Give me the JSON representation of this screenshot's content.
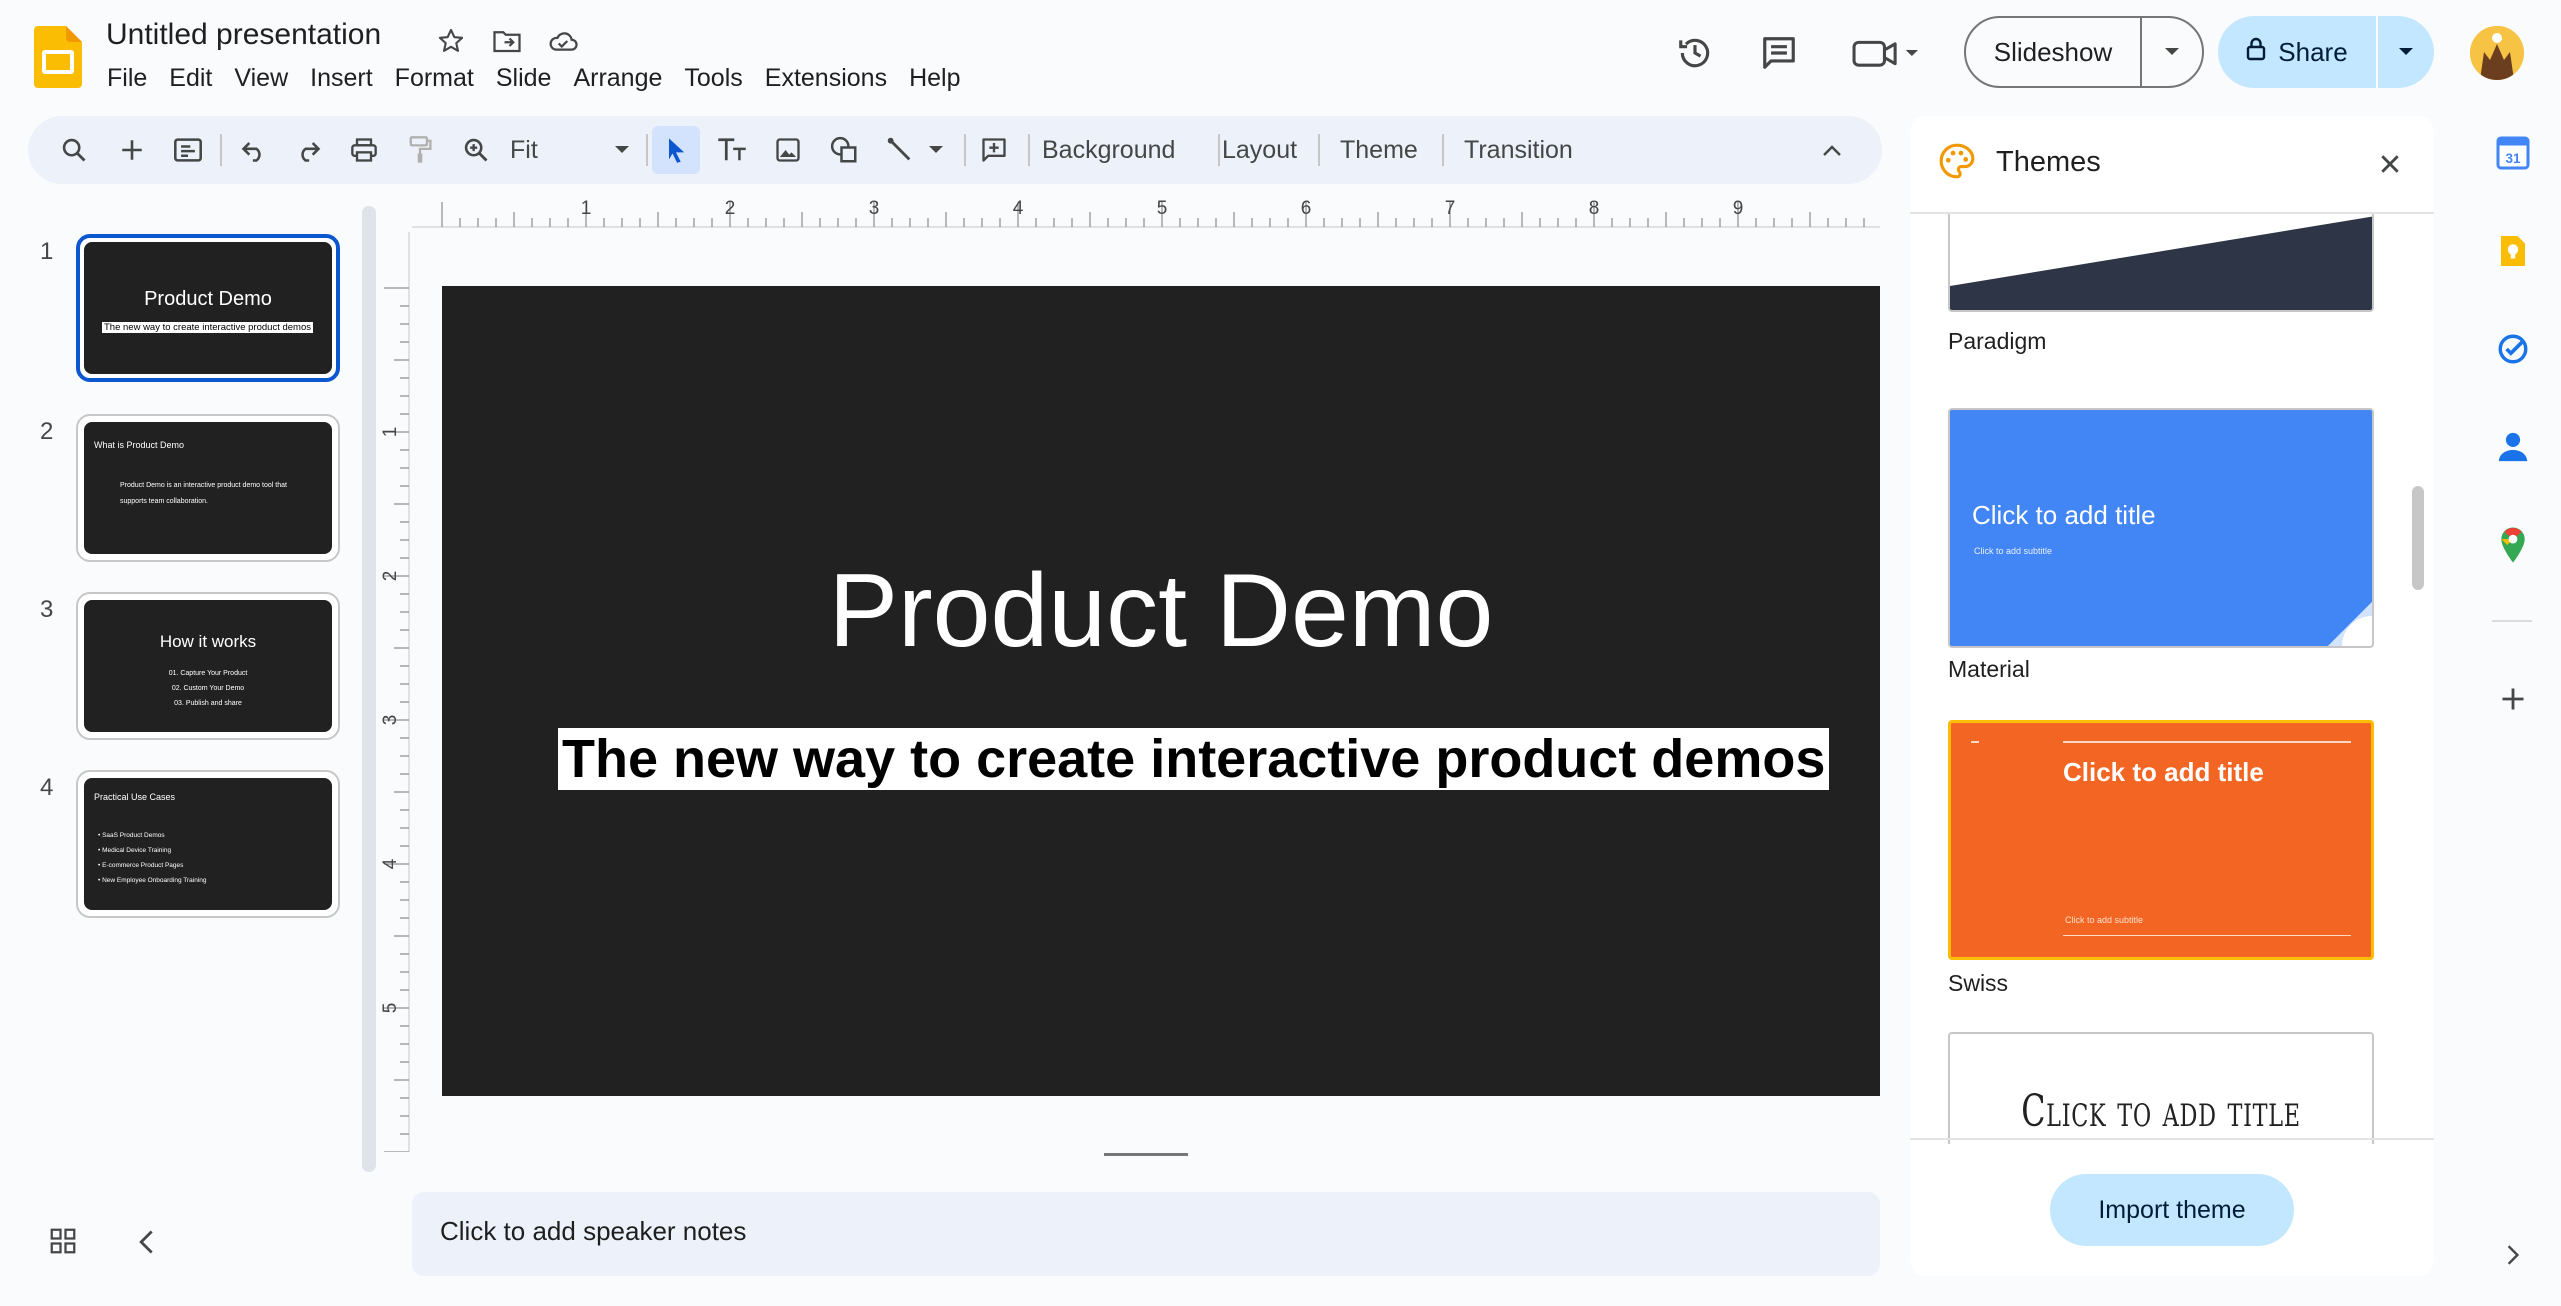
{
  "app": {
    "doc_title": "Untitled presentation",
    "menu": [
      "File",
      "Edit",
      "View",
      "Insert",
      "Format",
      "Slide",
      "Arrange",
      "Tools",
      "Extensions",
      "Help"
    ],
    "slideshow_label": "Slideshow",
    "share_label": "Share"
  },
  "toolbar": {
    "zoom_value": "Fit",
    "background_label": "Background",
    "layout_label": "Layout",
    "theme_label": "Theme",
    "transition_label": "Transition"
  },
  "filmstrip": {
    "slides": [
      {
        "number": "1",
        "title": "Product Demo",
        "subtitle": "The new way to create interactive product demos"
      },
      {
        "number": "2",
        "title": "What is Product Demo",
        "body": "Product Demo is an interactive product demo tool that supports team collaboration."
      },
      {
        "number": "3",
        "title": "How it works",
        "items": [
          "01. Capture Your Product",
          "02. Custom Your Demo",
          "03. Publish and share"
        ]
      },
      {
        "number": "4",
        "title": "Practical Use Cases",
        "items": [
          "SaaS Product Demos",
          "Medical Device Training",
          "E-commerce Product Pages",
          "New Employee Onboarding Training"
        ]
      }
    ]
  },
  "ruler": {
    "h_labels": [
      "1",
      "2",
      "3",
      "4",
      "5",
      "6",
      "7",
      "8",
      "9"
    ],
    "v_labels": [
      "1",
      "2",
      "3",
      "4",
      "5"
    ]
  },
  "slide": {
    "title": "Product Demo",
    "subtitle": "The new way to create interactive product demos"
  },
  "notes": {
    "placeholder": "Click to add speaker notes"
  },
  "themes_panel": {
    "title": "Themes",
    "themes": [
      {
        "name": "Paradigm"
      },
      {
        "name": "Material",
        "preview_title": "Click to add title",
        "preview_subtitle": "Click to add subtitle",
        "color": "#4285f4"
      },
      {
        "name": "Swiss",
        "preview_title": "Click to add title",
        "preview_subtitle": "Click to add subtitle",
        "color": "#f26522"
      },
      {
        "preview_title": "Click to add title"
      }
    ],
    "import_label": "Import theme"
  },
  "colors": {
    "accent_blue": "#0b57d0",
    "share_bg": "#c2e7ff",
    "slide_bg": "#212121",
    "paradigm_dark": "#2d3547"
  }
}
